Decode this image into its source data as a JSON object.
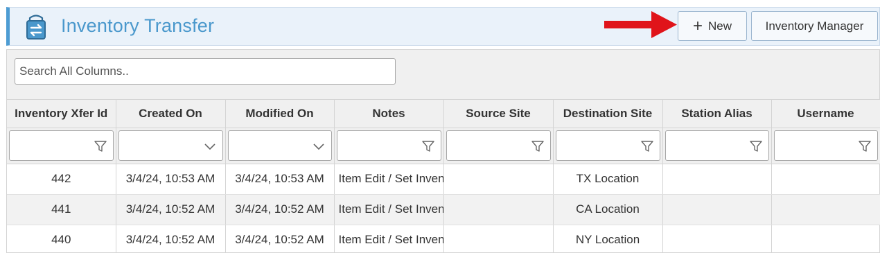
{
  "header": {
    "title": "Inventory Transfer",
    "icon": "inventory-transfer-icon",
    "new_label": "New",
    "manager_label": "Inventory Manager"
  },
  "search": {
    "placeholder": "Search All Columns.."
  },
  "columns": [
    "Inventory Xfer Id",
    "Created On",
    "Modified On",
    "Notes",
    "Source Site",
    "Destination Site",
    "Station Alias",
    "Username"
  ],
  "rows": [
    {
      "id": "442",
      "created": "3/4/24, 10:53 AM",
      "modified": "3/4/24, 10:53 AM",
      "notes": "Item Edit / Set Inventory",
      "source": "",
      "destination": "TX Location",
      "alias": "",
      "username": ""
    },
    {
      "id": "441",
      "created": "3/4/24, 10:52 AM",
      "modified": "3/4/24, 10:52 AM",
      "notes": "Item Edit / Set Inventory",
      "source": "",
      "destination": "CA Location",
      "alias": "",
      "username": ""
    },
    {
      "id": "440",
      "created": "3/4/24, 10:52 AM",
      "modified": "3/4/24, 10:52 AM",
      "notes": "Item Edit / Set Inventory",
      "source": "",
      "destination": "NY Location",
      "alias": "",
      "username": ""
    }
  ],
  "colors": {
    "accent": "#4a98cc",
    "arrow": "#e0141a",
    "header_bg": "#eaf2fa"
  }
}
